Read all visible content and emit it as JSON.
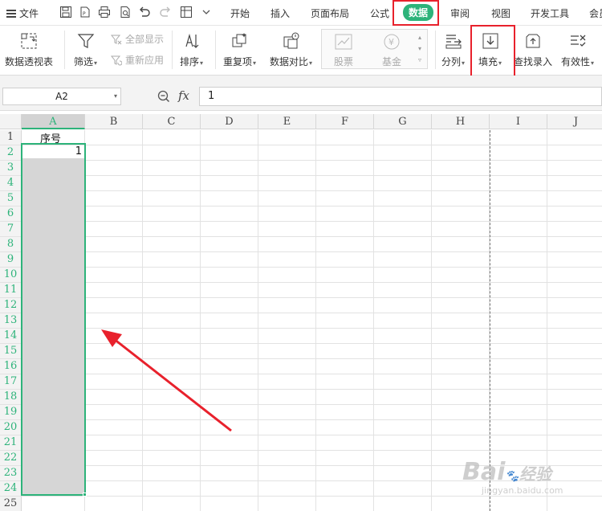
{
  "menubar": {
    "file_label": "文件",
    "tabs": [
      {
        "label": "开始"
      },
      {
        "label": "插入"
      },
      {
        "label": "页面布局"
      },
      {
        "label": "公式"
      },
      {
        "label": "数据",
        "active": true
      },
      {
        "label": "审阅"
      },
      {
        "label": "视图"
      },
      {
        "label": "开发工具"
      },
      {
        "label": "会员"
      }
    ]
  },
  "ribbon": {
    "pivot_label": "数据透视表",
    "filter_label": "筛选",
    "show_all_label": "全部显示",
    "reapply_label": "重新应用",
    "sort_label": "排序",
    "duplicate_label": "重复项",
    "compare_label": "数据对比",
    "stock_label": "股票",
    "fund_label": "基金",
    "split_label": "分列",
    "fill_label": "填充",
    "lookup_label": "查找录入",
    "validity_label": "有效性"
  },
  "formula_bar": {
    "cell_ref": "A2",
    "fx_label": "fx",
    "value": "1"
  },
  "sheet": {
    "columns": [
      "A",
      "B",
      "C",
      "D",
      "E",
      "F",
      "G",
      "H",
      "I",
      "J"
    ],
    "rows": [
      "1",
      "2",
      "3",
      "4",
      "5",
      "6",
      "7",
      "8",
      "9",
      "10",
      "11",
      "12",
      "13",
      "14",
      "15",
      "16",
      "17",
      "18",
      "19",
      "20",
      "21",
      "22",
      "23",
      "24",
      "25"
    ],
    "a1": "序号",
    "a2": "1",
    "selected_range": "A2:A24"
  },
  "watermark": {
    "brand": "Bai",
    "brand_tail": "经验",
    "url": "jingyan.baidu.com"
  },
  "colors": {
    "accent": "#2db37a",
    "highlight": "#e8212c",
    "selection_fill": "#d6d6d6"
  }
}
